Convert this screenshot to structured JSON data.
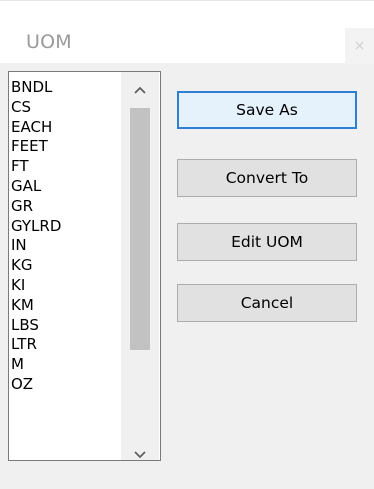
{
  "window": {
    "title": "UOM",
    "close_glyph": "×"
  },
  "list": {
    "items": [
      "BNDL",
      "CS",
      "EACH",
      "FEET",
      "FT",
      "GAL",
      "GR",
      "GYLRD",
      "IN",
      "KG",
      "KI",
      "KM",
      "LBS",
      "LTR",
      "M",
      "OZ"
    ],
    "scroll_up_icon": "chevron-up-icon",
    "scroll_down_icon": "chevron-down-icon"
  },
  "buttons": {
    "save_as": "Save As",
    "convert_to": "Convert To",
    "edit_uom": "Edit UOM",
    "cancel": "Cancel"
  },
  "colors": {
    "default_button_border": "#2f7fd2",
    "default_button_bg": "#e5f1fb"
  }
}
